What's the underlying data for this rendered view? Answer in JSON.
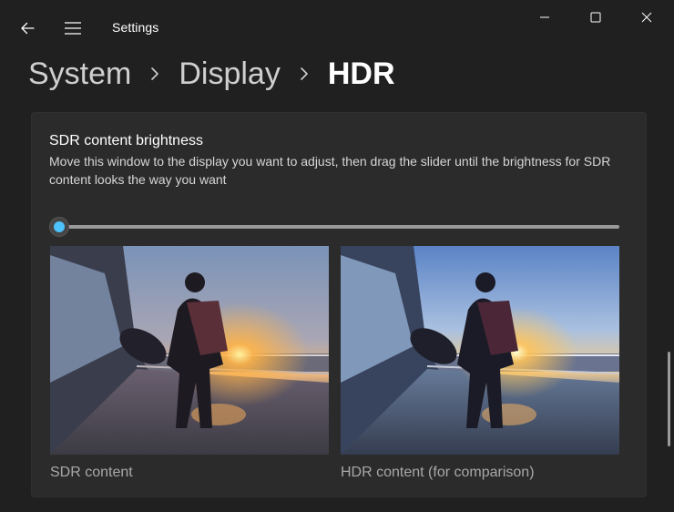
{
  "window": {
    "title": "Settings"
  },
  "breadcrumb": {
    "items": [
      "System",
      "Display",
      "HDR"
    ]
  },
  "card": {
    "title": "SDR content brightness",
    "description": "Move this window to the display you want to adjust, then drag the slider until the brightness for SDR content looks the way you want",
    "slider_value_fraction": 0.0,
    "accent_color": "#4cc2ff"
  },
  "previews": {
    "sdr_label": "SDR content",
    "hdr_label": "HDR content (for comparison)"
  }
}
